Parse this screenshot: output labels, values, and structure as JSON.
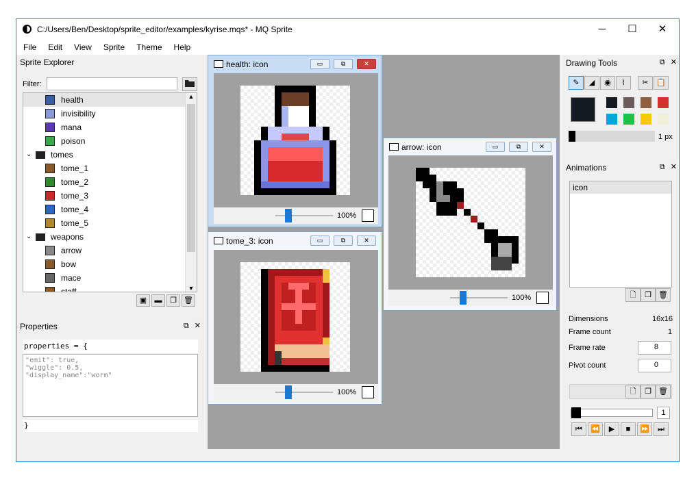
{
  "window": {
    "title": "C:/Users/Ben/Desktop/sprite_editor/examples/kyrise.mqs* - MQ Sprite",
    "minimize": "─",
    "maximize": "☐",
    "close": "✕"
  },
  "menu": [
    "File",
    "Edit",
    "View",
    "Sprite",
    "Theme",
    "Help"
  ],
  "sprite_explorer": {
    "title": "Sprite Explorer",
    "filter_label": "Filter:",
    "filter_value": "",
    "items": [
      {
        "label": "health",
        "type": "sprite",
        "color": "#3a5fa8",
        "selected": true
      },
      {
        "label": "invisibility",
        "type": "sprite",
        "color": "#8a9ad8"
      },
      {
        "label": "mana",
        "type": "sprite",
        "color": "#5a3ab8"
      },
      {
        "label": "poison",
        "type": "sprite",
        "color": "#3aa84a"
      },
      {
        "label": "tomes",
        "type": "folder"
      },
      {
        "label": "tome_1",
        "type": "sprite",
        "color": "#8b5a2b"
      },
      {
        "label": "tome_2",
        "type": "sprite",
        "color": "#2e8b2e"
      },
      {
        "label": "tome_3",
        "type": "sprite",
        "color": "#d02828"
      },
      {
        "label": "tome_4",
        "type": "sprite",
        "color": "#2868c8"
      },
      {
        "label": "tome_5",
        "type": "sprite",
        "color": "#b08830"
      },
      {
        "label": "weapons",
        "type": "folder"
      },
      {
        "label": "arrow",
        "type": "sprite",
        "color": "#888888"
      },
      {
        "label": "bow",
        "type": "sprite",
        "color": "#8b5a2b"
      },
      {
        "label": "mace",
        "type": "sprite",
        "color": "#666666"
      },
      {
        "label": "staff",
        "type": "sprite",
        "color": "#8b5a2b"
      }
    ]
  },
  "properties": {
    "title": "Properties",
    "open_line": "properties = {",
    "body": "\"emit\": true,\n\"wiggle\": 0.5,\n\"display_name\":\"worm\"",
    "close_line": "}"
  },
  "subwindows": [
    {
      "title": "health: icon",
      "zoom": "100%",
      "zoom_value": 0.5
    },
    {
      "title": "tome_3: icon",
      "zoom": "100%",
      "zoom_value": 0.5
    },
    {
      "title": "arrow: icon",
      "zoom": "100%",
      "zoom_value": 0.5
    }
  ],
  "drawing_tools": {
    "title": "Drawing Tools",
    "primary_color": "#141a21",
    "palette": [
      "#141a21",
      "#6e5c5c",
      "#8f6040",
      "#d62f2f",
      "#00a8d8",
      "#1ec245",
      "#f8c800",
      "#f0f0d8"
    ],
    "pen_size": "1 px"
  },
  "animations": {
    "title": "Animations",
    "list": [
      "icon"
    ],
    "dimensions_label": "Dimensions",
    "dimensions_value": "16x16",
    "frame_count_label": "Frame count",
    "frame_count_value": "1",
    "frame_rate_label": "Frame rate",
    "frame_rate_value": "8",
    "pivot_count_label": "Pivot count",
    "pivot_count_value": "0",
    "frame_index": "1"
  }
}
